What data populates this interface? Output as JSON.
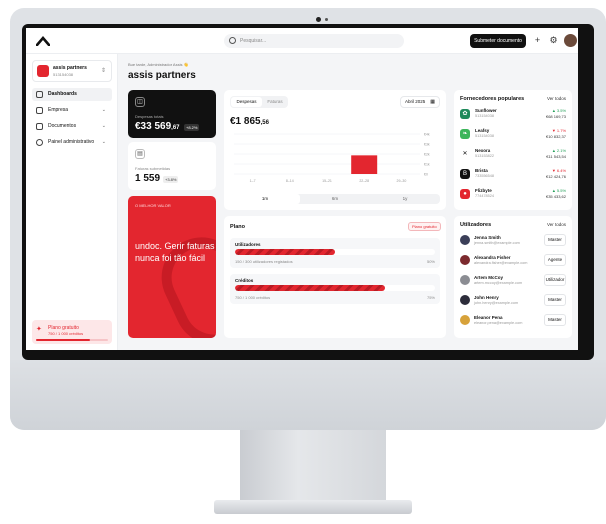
{
  "header": {
    "search_placeholder": "Pesquisar...",
    "submit_label": "Submeter documento"
  },
  "sidebar": {
    "org_name": "assis partners",
    "org_id": "513154038",
    "items": [
      {
        "label": "Dashboards"
      },
      {
        "label": "Empresa"
      },
      {
        "label": "Documentos"
      },
      {
        "label": "Painel administrativo"
      }
    ],
    "plan_title": "Plano gratuito",
    "plan_usage": "750 / 1 000 créditos",
    "plan_fraction": 0.75
  },
  "main": {
    "welcome": "Bue tarde, Administrador Assis 👋",
    "title": "assis partners"
  },
  "expenses_card": {
    "label": "Despesas totais",
    "value_main": "€33 569",
    "value_cents": ",67",
    "badge": "+8.2%"
  },
  "invoices_card": {
    "label": "Faturas submetidas",
    "value": "1 559",
    "badge": "+3.8%"
  },
  "promo": {
    "tag": "O MELHOR VALOR",
    "text": "undoc. Gerir faturas nunca foi tão fácil"
  },
  "chart_card": {
    "tab_a": "Despesas",
    "tab_b": "Faturas",
    "month": "Abril 2025",
    "value_main": "€1 865",
    "value_cents": ",56",
    "ranges": [
      "1m",
      "6m",
      "1y"
    ]
  },
  "chart_data": {
    "type": "bar",
    "categories": [
      "1–7",
      "8–14",
      "15–21",
      "22–28",
      "29–30"
    ],
    "values": [
      0,
      0,
      0,
      1865.56,
      0
    ],
    "ytick_labels": [
      "€4k",
      "€3k",
      "€2k",
      "€1k",
      "€0"
    ],
    "ylim": [
      0,
      4000
    ],
    "grid": true,
    "highlight_color": "#e3262f"
  },
  "plan_card": {
    "title": "Plano",
    "badge": "Plano gratuito",
    "users_label": "Utilizadores",
    "users_sub": "150 / 300 utilizadores registados",
    "users_pct": "50%",
    "users_fraction": 0.5,
    "credits_label": "Créditos",
    "credits_sub": "750 / 1 000 créditos",
    "credits_pct": "75%",
    "credits_fraction": 0.75
  },
  "suppliers": {
    "title": "Fornecedores populares",
    "link": "Ver todos",
    "rows": [
      {
        "name": "Sunflower",
        "id": "513154038",
        "pct": "▲ 3.5%",
        "amount": "€68 169,73",
        "color": "#1f8a5b",
        "up": true
      },
      {
        "name": "Leafsy",
        "id": "513154038",
        "pct": "▼ 1.7%",
        "amount": "€10 832,37",
        "color": "#3cb55a",
        "up": false
      },
      {
        "name": "Nexora",
        "id": "513153822",
        "pct": "▲ 2.1%",
        "amount": "€11 543,54",
        "color": "#111111",
        "up": true
      },
      {
        "name": "Brista",
        "id": "733556548",
        "pct": "▼ 6.4%",
        "amount": "€12 424,76",
        "color": "#111111",
        "up": false
      },
      {
        "name": "Flizbyte",
        "id": "774478524",
        "pct": "▲ 5.5%",
        "amount": "€35 433,62",
        "color": "#e3262f",
        "up": true
      }
    ]
  },
  "users": {
    "title": "Utilizadores",
    "link": "Ver todos",
    "rows": [
      {
        "name": "Jenna Smith",
        "email": "jenna.smith@example.com",
        "role": "Master",
        "color": "#3b3f58"
      },
      {
        "name": "Alexandra Fisher",
        "email": "alexandra.fisher@example.com",
        "role": "Agente",
        "color": "#7c2a2e"
      },
      {
        "name": "Artem McCoy",
        "email": "artem.mccoy@example.com",
        "role": "Utilizador",
        "color": "#8b8d93"
      },
      {
        "name": "John Henry",
        "email": "john.henry@example.com",
        "role": "Master",
        "color": "#2c2c3a"
      },
      {
        "name": "Eleanor Pena",
        "email": "eleanor.pena@example.com",
        "role": "Master",
        "color": "#d7a23a"
      }
    ]
  }
}
